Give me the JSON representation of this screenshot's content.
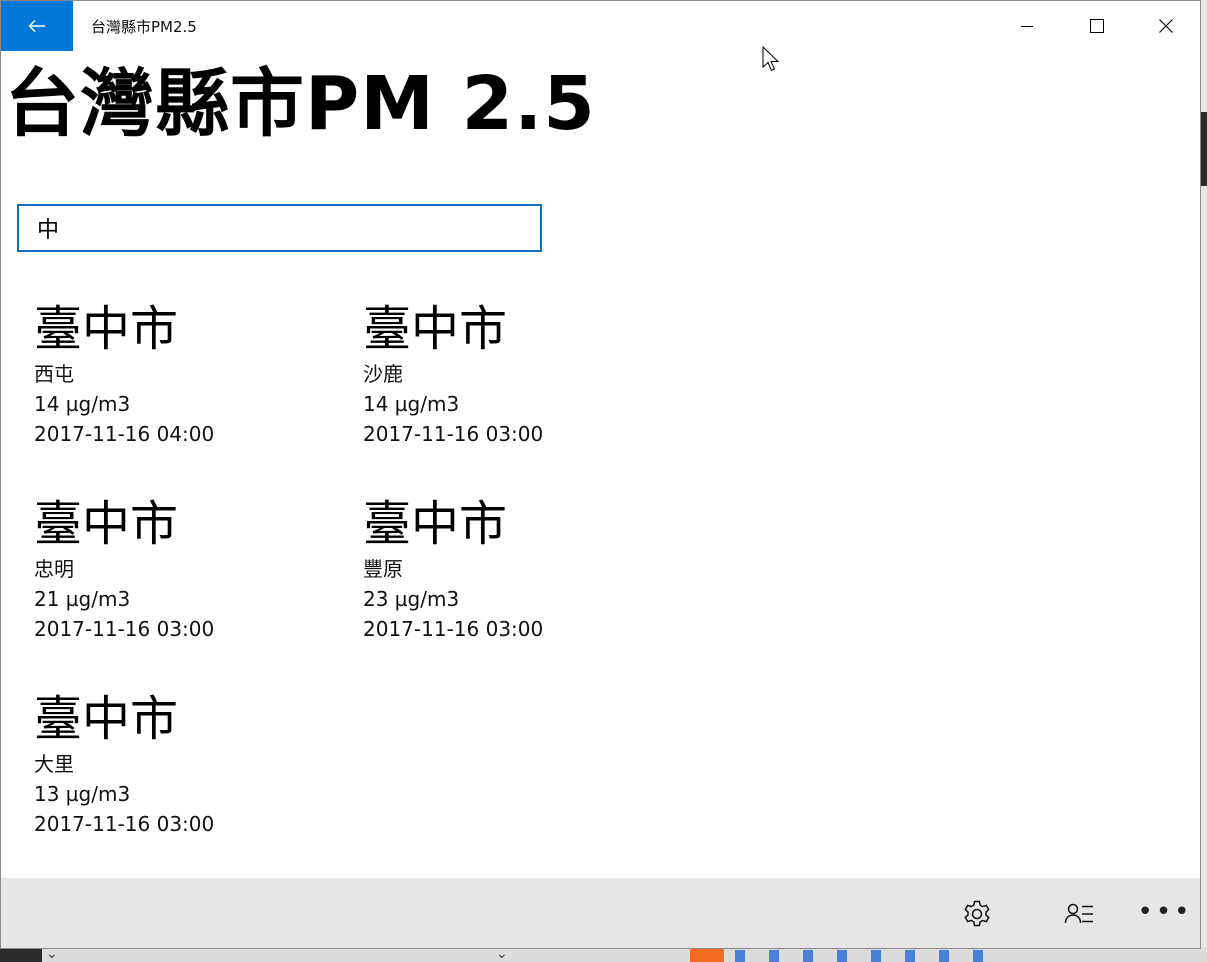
{
  "window": {
    "title": "台灣縣市PM2.5"
  },
  "page": {
    "title": "台灣縣市PM 2.5"
  },
  "search": {
    "value": "中"
  },
  "results": [
    {
      "city": "臺中市",
      "site": "西屯",
      "pm25": "14 µg/m3",
      "time": "2017-11-16 04:00"
    },
    {
      "city": "臺中市",
      "site": "沙鹿",
      "pm25": "14 µg/m3",
      "time": "2017-11-16 03:00"
    },
    {
      "city": "臺中市",
      "site": "忠明",
      "pm25": "21 µg/m3",
      "time": "2017-11-16 03:00"
    },
    {
      "city": "臺中市",
      "site": "豐原",
      "pm25": "23 µg/m3",
      "time": "2017-11-16 03:00"
    },
    {
      "city": "臺中市",
      "site": "大里",
      "pm25": "13 µg/m3",
      "time": "2017-11-16 03:00"
    }
  ],
  "icons": {
    "back": "back-arrow-icon",
    "minimize": "minimize-icon",
    "maximize": "maximize-icon",
    "close": "close-icon",
    "settings": "gear-icon",
    "people": "contact-list-icon",
    "more": "more-ellipsis-icon"
  },
  "colors": {
    "accent": "#0078d7",
    "commandbar": "#e6e6e6",
    "search_border": "#0a70c2"
  }
}
